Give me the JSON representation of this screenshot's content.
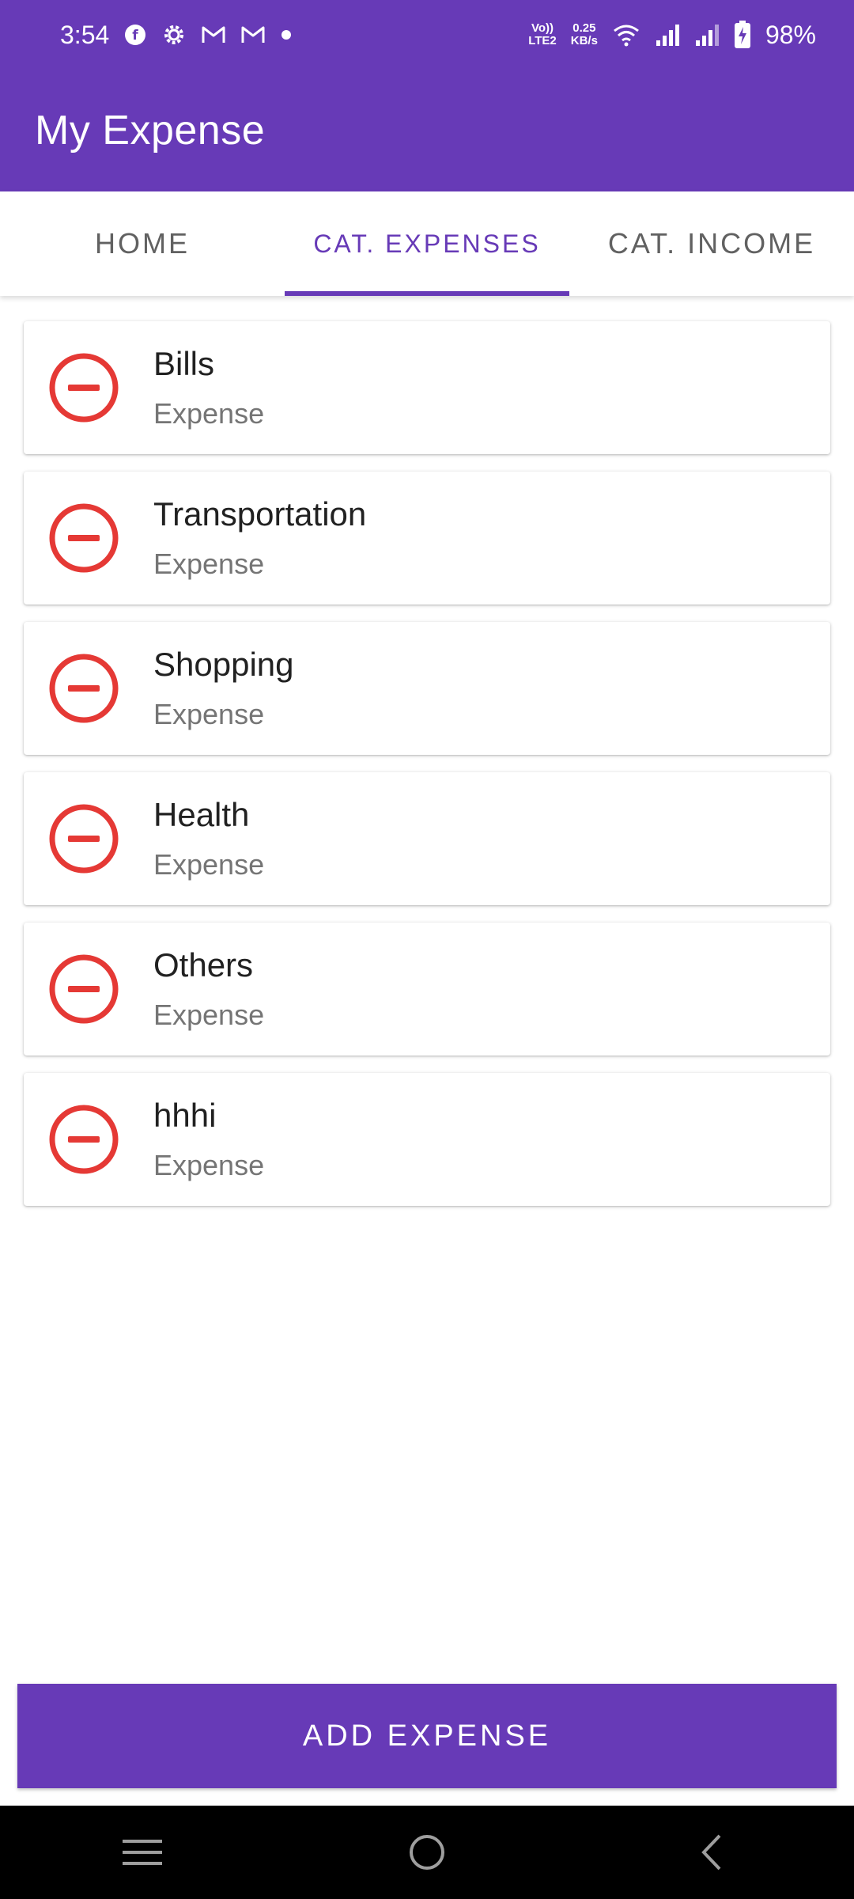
{
  "status_bar": {
    "time": "3:54",
    "net_speed_top": "0.25",
    "net_speed_bottom": "KB/s",
    "volte_top": "Vo))",
    "volte_bottom": "LTE2",
    "battery": "98%",
    "icons": [
      "notification-app-icon",
      "settings-gear-icon",
      "gmail-icon",
      "gmail-icon",
      "dot-icon",
      "volte-icon",
      "wifi-icon",
      "signal-icon",
      "signal-icon",
      "battery-charging-icon"
    ]
  },
  "app_bar": {
    "title": "My Expense"
  },
  "tabs": [
    {
      "label": "HOME",
      "active": false
    },
    {
      "label": "CAT. EXPENSES",
      "active": true
    },
    {
      "label": "CAT. INCOME",
      "active": false
    }
  ],
  "categories": [
    {
      "name": "Bills",
      "type": "Expense"
    },
    {
      "name": "Transportation",
      "type": "Expense"
    },
    {
      "name": "Shopping",
      "type": "Expense"
    },
    {
      "name": "Health",
      "type": "Expense"
    },
    {
      "name": "Others",
      "type": "Expense"
    },
    {
      "name": "hhhi",
      "type": "Expense"
    }
  ],
  "add_button": {
    "label": "ADD EXPENSE"
  },
  "colors": {
    "primary": "#673ab7",
    "expense_icon": "#e53935"
  },
  "nav_bar": {
    "icons": [
      "menu-icon",
      "home-circle-icon",
      "back-icon"
    ]
  }
}
